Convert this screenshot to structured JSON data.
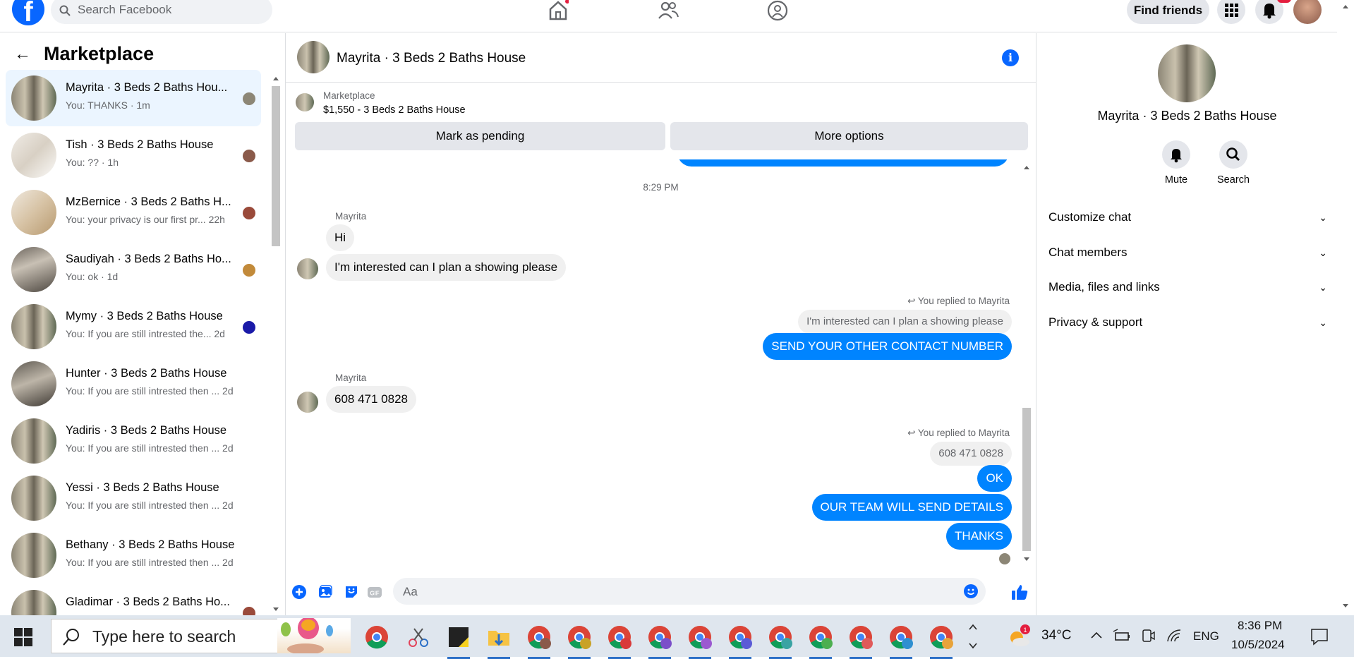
{
  "topbar": {
    "search_placeholder": "Search Facebook",
    "find_friends_label": "Find friends"
  },
  "sidebar": {
    "title": "Marketplace",
    "conversations": [
      {
        "name": "Mayrita · 3 Beds 2 Baths Hou...",
        "preview": "You: THANKS · 1m"
      },
      {
        "name": "Tish · 3 Beds 2 Baths House",
        "preview": "You: ?? · 1h"
      },
      {
        "name": "MzBernice · 3 Beds 2 Baths H...",
        "preview": "You: your privacy is our first pr...  22h"
      },
      {
        "name": "Saudiyah · 3 Beds 2 Baths Ho...",
        "preview": "You: ok · 1d"
      },
      {
        "name": "Mymy · 3 Beds 2 Baths House",
        "preview": "You: If you are still intrested the...  2d"
      },
      {
        "name": "Hunter · 3 Beds 2 Baths House",
        "preview": "You: If you are still intrested then ...   2d"
      },
      {
        "name": "Yadiris · 3 Beds 2 Baths House",
        "preview": "You: If you are still intrested then ...   2d"
      },
      {
        "name": "Yessi · 3 Beds 2 Baths House",
        "preview": "You: If you are still intrested then ...   2d"
      },
      {
        "name": "Bethany · 3 Beds 2 Baths House",
        "preview": "You: If you are still intrested then ...   2d"
      },
      {
        "name": "Gladimar · 3 Beds 2 Baths Ho...",
        "preview": ""
      }
    ]
  },
  "chat": {
    "title": "Mayrita · 3 Beds 2 Baths House",
    "marketplace_label": "Marketplace",
    "listing": "$1,550 - 3 Beds 2 Baths House",
    "mark_pending_label": "Mark as pending",
    "more_options_label": "More options",
    "timestamp": "8:29 PM",
    "sender_name": "Mayrita",
    "msg_hi": "Hi",
    "msg_interested": "I'm interested can I plan a showing please",
    "reply_note": "You replied to Mayrita",
    "quote_interested": "I'm interested can I plan a showing please",
    "msg_send_number": "SEND YOUR OTHER CONTACT NUMBER",
    "msg_number": "608 471 0828",
    "quote_number": "608 471 0828",
    "msg_ok": "OK",
    "msg_team": "OUR TEAM WILL SEND DETAILS",
    "msg_thanks": "THANKS",
    "composer_placeholder": "Aa"
  },
  "right_panel": {
    "title": "Mayrita · 3 Beds 2 Baths House",
    "mute_label": "Mute",
    "search_label": "Search",
    "items": [
      "Customize chat",
      "Chat members",
      "Media, files and links",
      "Privacy & support"
    ]
  },
  "taskbar": {
    "search_placeholder": "Type here to search",
    "weather": "34°C",
    "language": "ENG",
    "time": "8:36 PM",
    "date": "10/5/2024",
    "weather_badge": "1"
  }
}
